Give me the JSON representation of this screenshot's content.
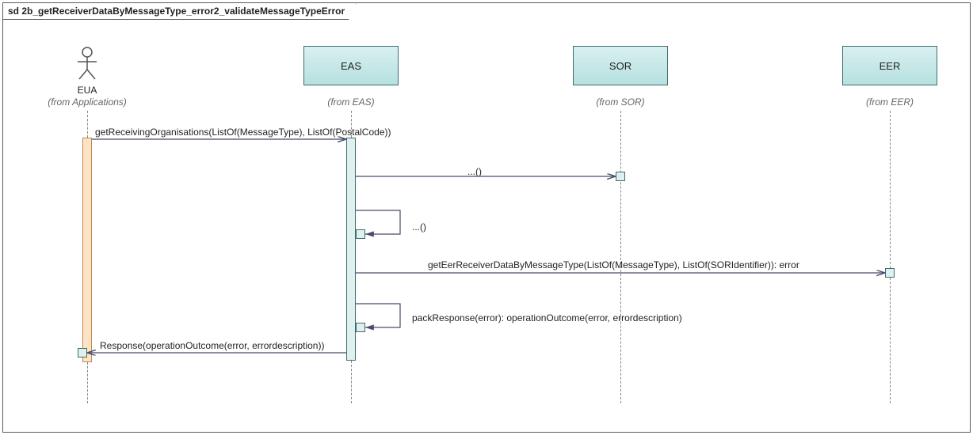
{
  "frame": {
    "prefix": "sd",
    "title": "2b_getReceiverDataByMessageType_error2_validateMessageTypeError"
  },
  "participants": {
    "eua": {
      "name": "EUA",
      "from": "(from Applications)"
    },
    "eas": {
      "name": "EAS",
      "from": "(from EAS)"
    },
    "sor": {
      "name": "SOR",
      "from": "(from SOR)"
    },
    "eer": {
      "name": "EER",
      "from": "(from EER)"
    }
  },
  "messages": {
    "m1": "getReceivingOrganisations(ListOf(MessageType), ListOf(PostalCode))",
    "m2": "...()",
    "m3": "...()",
    "m4": "getEerReceiverDataByMessageType(ListOf(MessageType), ListOf(SORIdentifier)): error",
    "m5": "packResponse(error): operationOutcome(error, errordescription)",
    "m6": "Response(operationOutcome(error, errordescription))"
  },
  "chart_data": {
    "type": "sequence-diagram",
    "title": "sd 2b_getReceiverDataByMessageType_error2_validateMessageTypeError",
    "participants": [
      {
        "id": "EUA",
        "stereotype": "actor",
        "package": "Applications"
      },
      {
        "id": "EAS",
        "stereotype": "component",
        "package": "EAS"
      },
      {
        "id": "SOR",
        "stereotype": "component",
        "package": "SOR"
      },
      {
        "id": "EER",
        "stereotype": "component",
        "package": "EER"
      }
    ],
    "messages": [
      {
        "from": "EUA",
        "to": "EAS",
        "label": "getReceivingOrganisations(ListOf(MessageType), ListOf(PostalCode))",
        "kind": "sync"
      },
      {
        "from": "EAS",
        "to": "SOR",
        "label": "...()",
        "kind": "sync"
      },
      {
        "from": "EAS",
        "to": "EAS",
        "label": "...()",
        "kind": "self"
      },
      {
        "from": "EAS",
        "to": "EER",
        "label": "getEerReceiverDataByMessageType(ListOf(MessageType), ListOf(SORIdentifier)): error",
        "kind": "sync"
      },
      {
        "from": "EAS",
        "to": "EAS",
        "label": "packResponse(error): operationOutcome(error, errordescription)",
        "kind": "self"
      },
      {
        "from": "EAS",
        "to": "EUA",
        "label": "Response(operationOutcome(error, errordescription))",
        "kind": "return"
      }
    ]
  }
}
